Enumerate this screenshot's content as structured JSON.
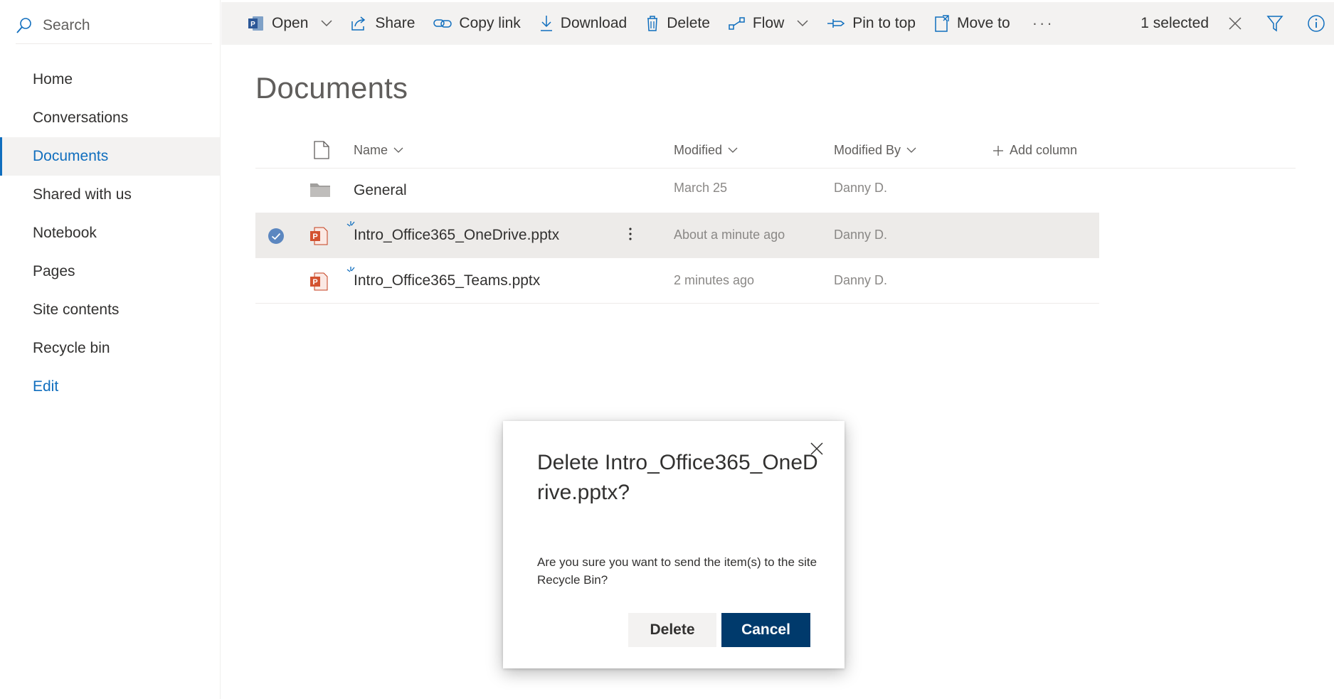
{
  "search": {
    "placeholder": "Search"
  },
  "nav": {
    "items": [
      {
        "label": "Home"
      },
      {
        "label": "Conversations"
      },
      {
        "label": "Documents",
        "active": true
      },
      {
        "label": "Shared with us"
      },
      {
        "label": "Notebook"
      },
      {
        "label": "Pages"
      },
      {
        "label": "Site contents"
      },
      {
        "label": "Recycle bin"
      }
    ],
    "edit_label": "Edit"
  },
  "commandbar": {
    "open": "Open",
    "share": "Share",
    "copy_link": "Copy link",
    "download": "Download",
    "delete": "Delete",
    "flow": "Flow",
    "pin_to_top": "Pin to top",
    "move_to": "Move to",
    "more": "···",
    "selected_count": "1 selected"
  },
  "page": {
    "title": "Documents"
  },
  "table": {
    "columns": {
      "name": "Name",
      "modified": "Modified",
      "modified_by": "Modified By",
      "add_column": "Add column"
    },
    "rows": [
      {
        "type": "folder",
        "name": "General",
        "modified": "March 25",
        "modified_by": "Danny D.",
        "selected": false
      },
      {
        "type": "pptx",
        "name": "Intro_Office365_OneDrive.pptx",
        "modified": "About a minute ago",
        "modified_by": "Danny D.",
        "selected": true
      },
      {
        "type": "pptx",
        "name": "Intro_Office365_Teams.pptx",
        "modified": "2 minutes ago",
        "modified_by": "Danny D.",
        "selected": false
      }
    ]
  },
  "dialog": {
    "title": "Delete Intro_Office365_OneDrive.pptx?",
    "body": "Are you sure you want to send the item(s) to the site Recycle Bin?",
    "delete_label": "Delete",
    "cancel_label": "Cancel"
  },
  "colors": {
    "accent": "#106ebe",
    "primary_button": "#003a6c",
    "commandbar_bg": "#f3f2f1",
    "selected_row": "#edebe9",
    "ppt": "#c43e1c"
  }
}
